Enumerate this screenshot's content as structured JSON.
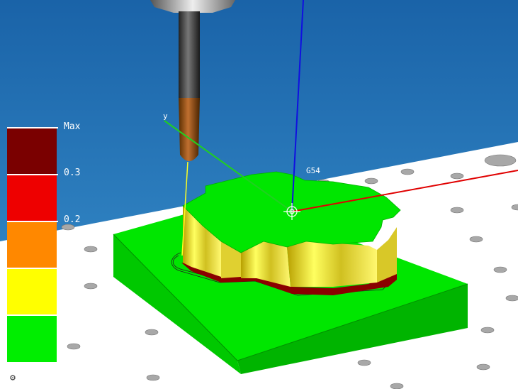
{
  "scene": {
    "colors": {
      "sky_top": "#1a63a8",
      "sky_bottom": "#3b93cf",
      "table": "#ffffff",
      "stock_green": "#00e600",
      "x_axis": "#e00000",
      "y_axis": "#20d020",
      "z_axis": "#1010e0"
    },
    "wcs_label": "G54",
    "y_axis_label": "y"
  },
  "legend": {
    "labels": {
      "max": "Max",
      "v03": "0.3",
      "v02": "0.2"
    },
    "bands": [
      "#7a0000",
      "#ee0000",
      "#ff8800",
      "#ffff00",
      "#00ee00"
    ]
  },
  "toolbar": {
    "settings_icon": "gear-icon",
    "settings_glyph": "⚙"
  }
}
